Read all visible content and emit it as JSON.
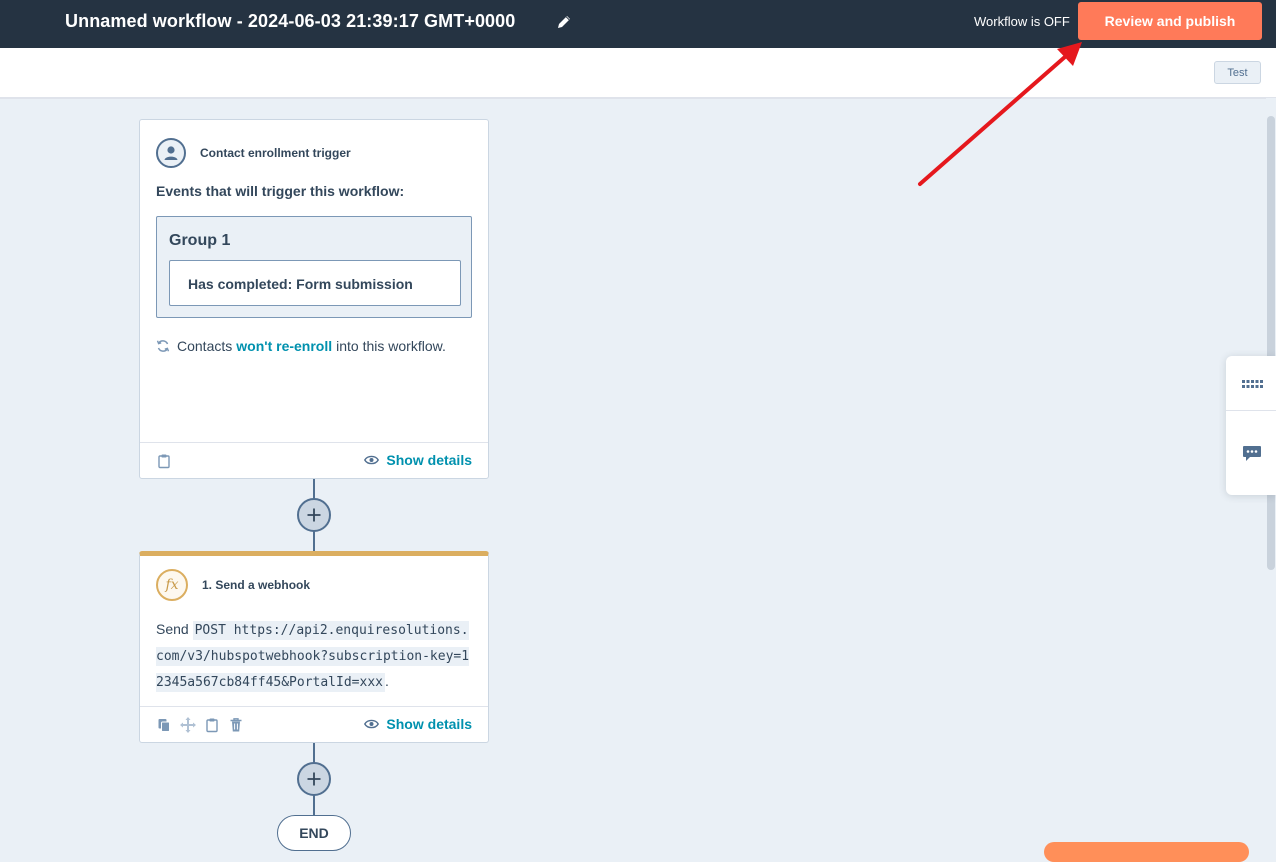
{
  "header": {
    "title": "Unnamed workflow - 2024-06-03 21:39:17 GMT+0000",
    "status": "Workflow is OFF",
    "publish_label": "Review and publish"
  },
  "subbar": {
    "test_label": "Test"
  },
  "trigger_card": {
    "title": "Contact enrollment trigger",
    "events_label": "Events that will trigger this workflow:",
    "group_title": "Group 1",
    "filter": "Has completed: Form submission",
    "reenroll_prefix": "Contacts",
    "reenroll_link": "won't re-enroll",
    "reenroll_suffix": "into this workflow.",
    "show_details": "Show details"
  },
  "action_card": {
    "title": "1. Send a webhook",
    "send_prefix": "Send",
    "request": "POST https://api2.enquiresolutions.com/v3/hubspotwebhook?subscription-key=12345a567cb84ff45&PortalId=xxx",
    "send_suffix": ".",
    "show_details": "Show details"
  },
  "end_label": "END",
  "colors": {
    "topbar": "#253342",
    "publish": "#ff7a59",
    "link": "#0091ae",
    "canvas": "#eaf0f6",
    "action_accent": "#dbae60",
    "annotation_arrow": "#e5181d"
  },
  "icons": [
    "edit-icon",
    "contact-icon",
    "fx-icon",
    "refresh-icon",
    "clipboard-icon",
    "copy-icon",
    "move-icon",
    "delete-icon",
    "eye-icon",
    "plus-icon",
    "grid-icon",
    "chat-icon"
  ]
}
